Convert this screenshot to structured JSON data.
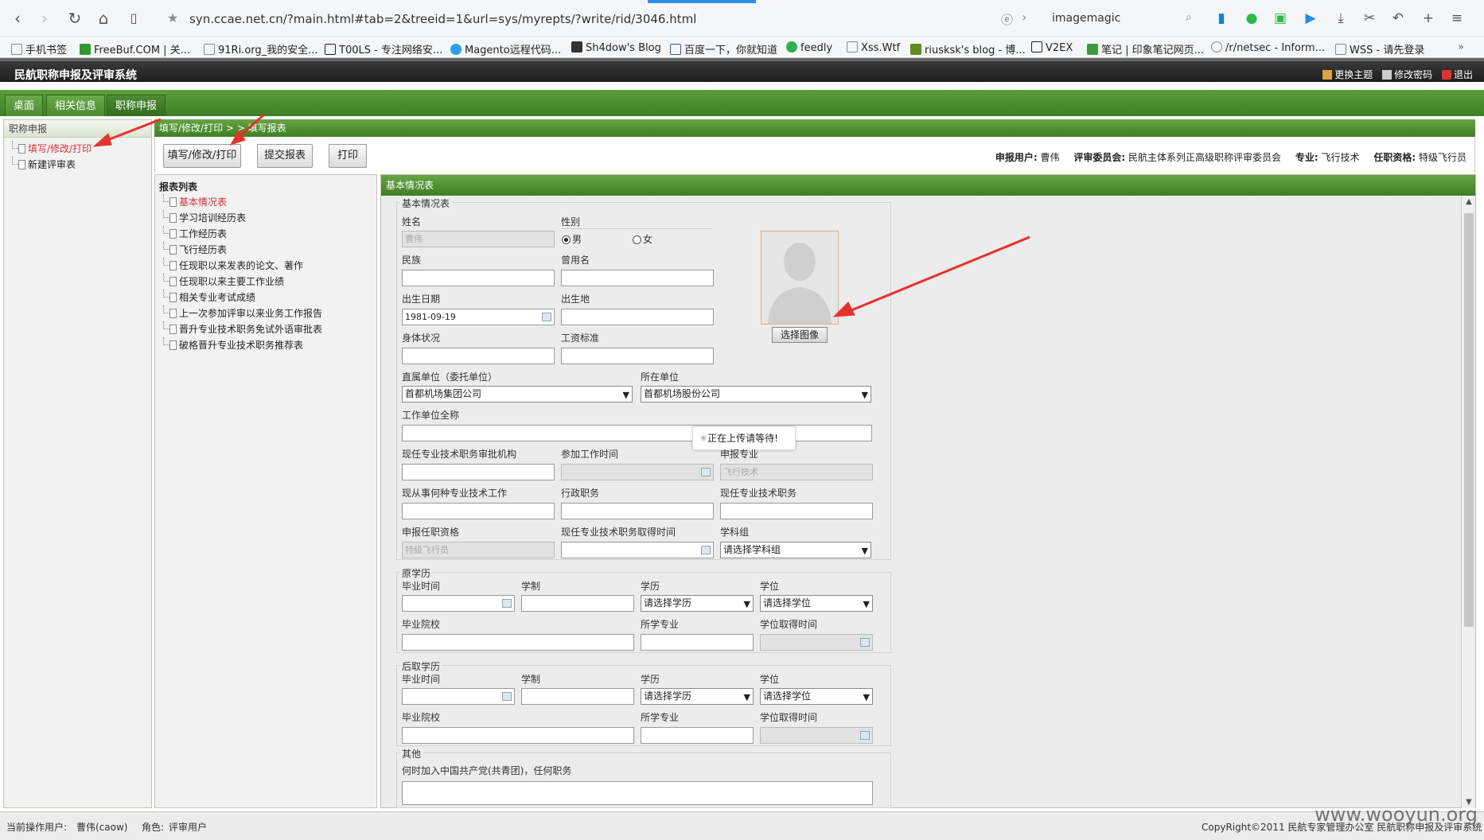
{
  "browser": {
    "url": "syn.ccae.net.cn/?main.html#tab=2&treeid=1&url=sys/myrepts/?write/rid/3046.html",
    "search": "imagemagic",
    "bookmarks": [
      "手机书签",
      "FreeBuf.COM | 关...",
      "91Ri.org_我的安全...",
      "T00LS - 专注网络安...",
      "Magento远程代码...",
      "Sh4dow's Blog",
      "百度一下，你就知道",
      "feedly",
      "Xss.Wtf",
      "riusksk's blog - 博...",
      "V2EX",
      "笔记 | 印象笔记网页...",
      "/r/netsec - Inform...",
      "WSS - 请先登录"
    ]
  },
  "app": {
    "title": "民航职称申报及评审系统",
    "top_links": [
      "更换主题",
      "修改密码",
      "退出"
    ],
    "tabs": [
      "桌面",
      "相关信息",
      "职称申报"
    ]
  },
  "left_panel": {
    "title": "职称申报",
    "items": [
      "填写/修改/打印",
      "新建评审表"
    ]
  },
  "breadcrumb": "填写/修改/打印 > > 填写报表",
  "toolbar": {
    "buttons": [
      "填写/修改/打印",
      "提交报表",
      "打印"
    ],
    "user_label": "申报用户:",
    "user_value": "曹伟",
    "committee_label": "评审委员会:",
    "committee_value": "民航主体系列正高级职称评审委员会",
    "major_label": "专业:",
    "major_value": "飞行技术",
    "qual_label": "任职资格:",
    "qual_value": "特级飞行员"
  },
  "report_list": {
    "title": "报表列表",
    "items": [
      "基本情况表",
      "学习培训经历表",
      "工作经历表",
      "飞行经历表",
      "任现职以来发表的论文、著作",
      "任现职以来主要工作业绩",
      "相关专业考试成绩",
      "上一次参加评审以来业务工作报告",
      "晋升专业技术职务免试外语审批表",
      "破格晋升专业技术职务推荐表"
    ]
  },
  "form": {
    "header": "基本情况表",
    "basic_legend": "基本情况表",
    "name_label": "姓名",
    "name_value": "曹伟",
    "gender_label": "性别",
    "gender_male": "男",
    "gender_female": "女",
    "ethnic_label": "民族",
    "former_name_label": "曾用名",
    "birth_label": "出生日期",
    "birth_value": "1981-09-19",
    "birthplace_label": "出生地",
    "health_label": "身体状况",
    "salary_label": "工资标准",
    "direct_unit_label": "直属单位（委托单位）",
    "direct_unit_value": "首都机场集团公司",
    "unit_label": "所在单位",
    "unit_value": "首都机场股份公司",
    "fullname_label": "工作单位全称",
    "approve_org_label": "现任专业技术职务审批机构",
    "work_start_label": "参加工作时间",
    "apply_major_label": "申报专业",
    "apply_major_value": "飞行技术",
    "tech_work_label": "现从事何种专业技术工作",
    "admin_label": "行政职务",
    "tech_post_label": "现任专业技术职务",
    "apply_qual_label": "申报任职资格",
    "apply_qual_value": "特级飞行员",
    "post_time_label": "现任专业技术职务取得时间",
    "subject_label": "学科组",
    "subject_value": "请选择学科组",
    "photo_button": "选择图像",
    "loading": "正在上传请等待!",
    "orig_edu_legend": "原学历",
    "later_edu_legend": "后取学历",
    "grad_time_label": "毕业时间",
    "schooling_label": "学制",
    "edu_label": "学历",
    "edu_value": "请选择学历",
    "degree_label": "学位",
    "degree_value": "请选择学位",
    "school_label": "毕业院校",
    "major_label": "所学专业",
    "degree_time_label": "学位取得时间",
    "other_legend": "其他",
    "party_label": "何时加入中国共产党(共青团)，任何职务"
  },
  "status": {
    "user_label": "当前操作用户:",
    "user_value": "曹伟(caow)",
    "role_label": "角色:",
    "role_value": "评审用户",
    "copyright": "CopyRight©2011 民航专家管理办公室 民航职称申报及评审系统",
    "watermark": "www.wooyun.org"
  },
  "colors": {
    "green": "#4c8a31",
    "accent_red": "#e8312a",
    "highlight": "#d43030"
  }
}
